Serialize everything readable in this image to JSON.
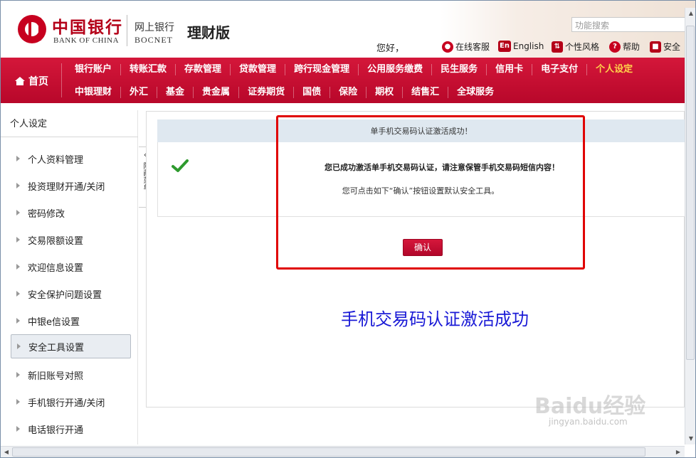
{
  "header": {
    "bank_name_cn": "中国银行",
    "bank_name_en": "BANK OF CHINA",
    "ebank_cn": "网上银行",
    "ebank_en": "BOCNET",
    "edition": "理财版",
    "search_placeholder": "功能搜索",
    "greeting": "您好，",
    "links": {
      "customer_service": "在线客服",
      "english": "English",
      "english_icon": "En",
      "style": "个性风格",
      "help": "帮助",
      "security": "安全"
    }
  },
  "nav": {
    "home": "首页",
    "row1": [
      "银行账户",
      "转账汇款",
      "存款管理",
      "贷款管理",
      "跨行现金管理",
      "公用服务缴费",
      "民生服务",
      "信用卡",
      "电子支付",
      "个人设定"
    ],
    "row2": [
      "中银理财",
      "外汇",
      "基金",
      "贵金属",
      "证券期货",
      "国债",
      "保险",
      "期权",
      "结售汇",
      "全球服务"
    ],
    "active": "个人设定"
  },
  "sidebar": {
    "title": "个人设定",
    "items": [
      "个人资料管理",
      "投资理财开通/关闭",
      "密码修改",
      "交易限额设置",
      "欢迎信息设置",
      "安全保护问题设置",
      "中银e信设置",
      "安全工具设置",
      "新旧账号对照",
      "手机银行开通/关闭",
      "电话银行开通"
    ],
    "active_index": 7,
    "collapse_label": "隐藏菜单"
  },
  "dialog": {
    "title": "单手机交易码认证激活成功！",
    "message": "您已成功激活单手机交易码认证，请注意保管手机交易码短信内容！",
    "hint": "您可点击如下“确认”按钮设置默认安全工具。",
    "confirm_label": "确认"
  },
  "caption": "手机交易码认证激活成功",
  "watermark": {
    "logo": "Baidu经验",
    "url": "jingyan.baidu.com"
  },
  "colors": {
    "brand_red": "#c7001f",
    "nav_active": "#ffd24a",
    "caption_blue": "#1a1ad6",
    "highlight_red": "#e00000"
  }
}
